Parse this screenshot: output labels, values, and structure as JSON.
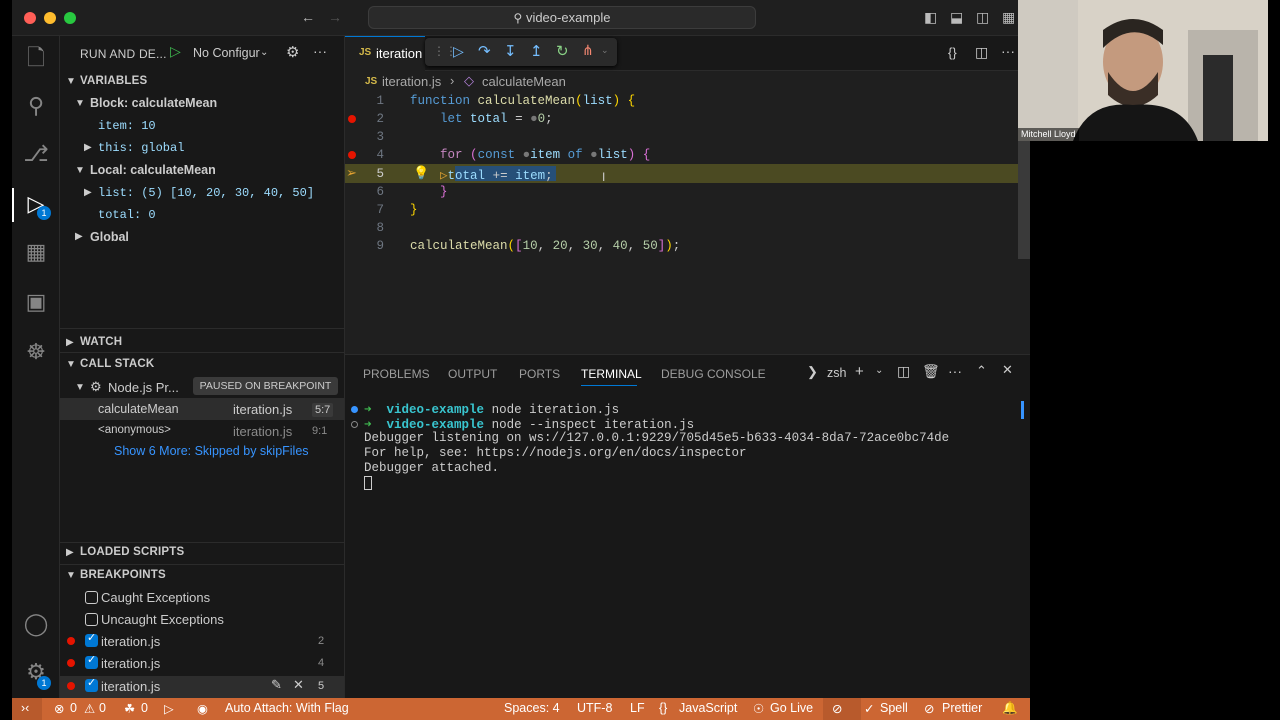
{
  "window": {
    "command_center": "video-example"
  },
  "sidebar": {
    "run_title": "RUN AND DE...",
    "config": "No Configur",
    "variables_title": "VARIABLES",
    "block_scope": "Block: calculateMean",
    "item_var": "item: 10",
    "this_var": "this: global",
    "local_scope": "Local: calculateMean",
    "list_var": "list: (5) [10, 20, 30, 40, 50]",
    "total_var": "total: 0",
    "global_scope": "Global",
    "watch_title": "WATCH",
    "callstack_title": "CALL STACK",
    "process_name": "Node.js Pr...",
    "paused_label": "PAUSED ON BREAKPOINT",
    "frames": [
      {
        "name": "calculateMean",
        "file": "iteration.js",
        "pos": "5:7"
      },
      {
        "name": "<anonymous>",
        "file": "iteration.js",
        "pos": "9:1"
      }
    ],
    "show_more": "Show 6 More: Skipped by skipFiles",
    "loaded_scripts_title": "LOADED SCRIPTS",
    "breakpoints_title": "BREAKPOINTS",
    "caught": "Caught Exceptions",
    "uncaught": "Uncaught Exceptions",
    "breakpoints": [
      {
        "file": "iteration.js",
        "line": "2"
      },
      {
        "file": "iteration.js",
        "line": "4"
      },
      {
        "file": "iteration.js",
        "line": "5"
      }
    ]
  },
  "activity": {
    "debug_badge": "1",
    "settings_badge": "1"
  },
  "editor": {
    "tab_label": "iteration",
    "breadcrumb_file": "iteration.js",
    "breadcrumb_symbol": "calculateMean",
    "line_numbers": [
      "1",
      "2",
      "3",
      "4",
      "5",
      "6",
      "7",
      "8",
      "9"
    ]
  },
  "panel": {
    "tabs": [
      "PROBLEMS",
      "OUTPUT",
      "PORTS",
      "TERMINAL",
      "DEBUG CONSOLE"
    ],
    "active_tab": "TERMINAL",
    "shell": "zsh",
    "terminal": [
      {
        "prompt": "video-example",
        "cmd": "node iteration.js"
      },
      {
        "prompt": "video-example",
        "cmd": "node --inspect iteration.js"
      }
    ],
    "output_lines": [
      "Debugger listening on ws://127.0.0.1:9229/705d45e5-b633-4034-8da7-72ace0bc74de",
      "For help, see: https://nodejs.org/en/docs/inspector",
      "Debugger attached."
    ]
  },
  "status": {
    "errors": "0",
    "warnings": "0",
    "ports": "0",
    "auto_attach": "Auto Attach: With Flag",
    "spaces": "Spaces: 4",
    "encoding": "UTF-8",
    "eol": "LF",
    "language": "JavaScript",
    "golive": "Go Live",
    "spell": "Spell",
    "prettier": "Prettier"
  },
  "webcam": {
    "name": "Mitchell Lloyd"
  },
  "colors": {
    "status_bar": "#cc6633",
    "accent": "#0078d4",
    "breakpoint": "#e51400",
    "current_line": "#4b4a22"
  }
}
